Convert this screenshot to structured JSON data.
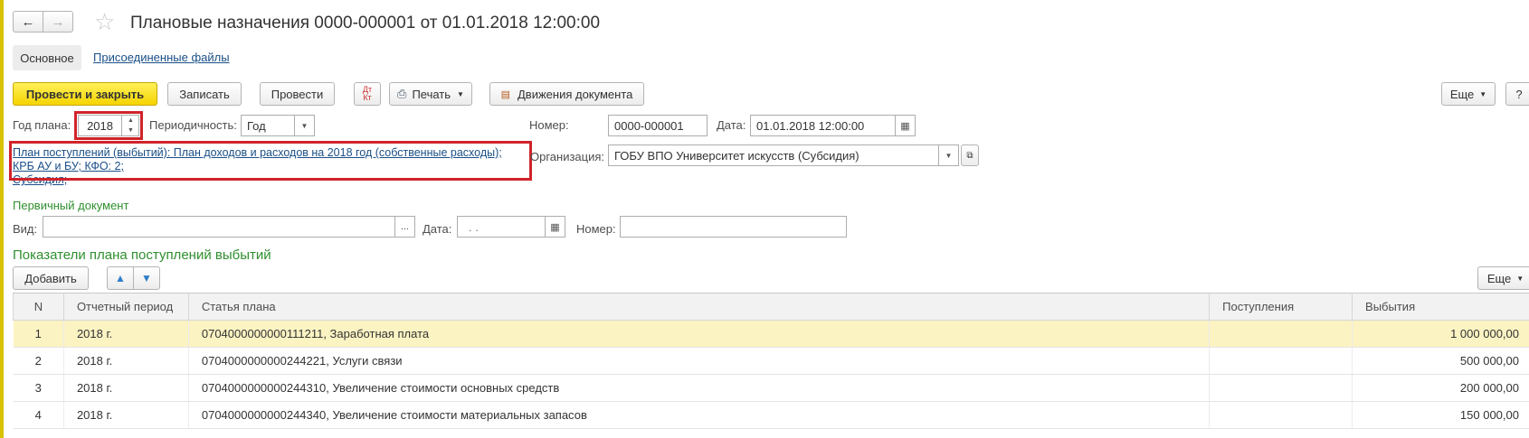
{
  "header": {
    "title": "Плановые назначения 0000-000001 от 01.01.2018 12:00:00"
  },
  "tabs": [
    {
      "label": "Основное"
    },
    {
      "label": "Присоединенные файлы"
    }
  ],
  "toolbar": {
    "post_close": "Провести и закрыть",
    "save": "Записать",
    "post": "Провести",
    "print": "Печать",
    "movements": "Движения документа",
    "more": "Еще",
    "help": "?"
  },
  "form": {
    "year_label": "Год плана:",
    "year_value": "2018",
    "period_label": "Периодичность:",
    "period_value": "Год",
    "number_label": "Номер:",
    "number_value": "0000-000001",
    "date_label": "Дата:",
    "date_value": "01.01.2018 12:00:00",
    "plan_link_line1": "План поступлений (выбытий): План доходов и расходов на 2018 год (собственные расходы);",
    "plan_link_line2": "КРБ АУ и БУ; КФО: 2;",
    "plan_link_line3": "Субсидия;",
    "org_label": "Организация:",
    "org_value": "ГОБУ ВПО Университет искусств (Субсидия)"
  },
  "primary_doc": {
    "heading": "Первичный документ",
    "kind_label": "Вид:",
    "kind_value": "",
    "date_label": "Дата:",
    "date_value": " .  .",
    "number_label": "Номер:",
    "number_value": ""
  },
  "indicators": {
    "heading": "Показатели плана поступлений выбытий",
    "add": "Добавить",
    "more": "Еще",
    "columns": [
      "N",
      "Отчетный период",
      "Статья плана",
      "Поступления",
      "Выбытия"
    ],
    "rows": [
      {
        "n": "1",
        "period": "2018 г.",
        "article": "0704000000000111211, Заработная плата",
        "income": "",
        "outcome": "1 000 000,00"
      },
      {
        "n": "2",
        "period": "2018 г.",
        "article": "0704000000000244221, Услуги связи",
        "income": "",
        "outcome": "500 000,00"
      },
      {
        "n": "3",
        "period": "2018 г.",
        "article": "0704000000000244310, Увеличение стоимости основных средств",
        "income": "",
        "outcome": "200 000,00"
      },
      {
        "n": "4",
        "period": "2018 г.",
        "article": "0704000000000244340, Увеличение стоимости материальных запасов",
        "income": "",
        "outcome": "150 000,00"
      }
    ]
  },
  "colors": {
    "accent_yellow": "#f5d400",
    "highlight_red": "#d1232a",
    "section_green": "#2f8f2f",
    "link_blue": "#1a4f87"
  }
}
